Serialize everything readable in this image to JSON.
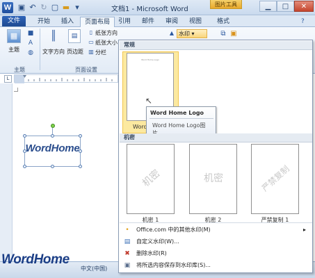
{
  "window": {
    "title": "文档1 - Microsoft Word",
    "context_tab": "图片工具",
    "word_icon": "W",
    "minimize_glyph": "▁",
    "maximize_glyph": "□",
    "close_glyph": "✕"
  },
  "tabs": {
    "file": "文件",
    "items": [
      "开始",
      "插入",
      "页面布局",
      "引用",
      "邮件",
      "审阅",
      "视图",
      "格式"
    ],
    "active": "页面布局"
  },
  "ribbon": {
    "theme_label": "主题",
    "theme_group": "主题",
    "text_direction": "文字方向",
    "margins": "页边距",
    "paper_direction": "纸张方向",
    "paper_size": "纸张大小",
    "columns": "分栏",
    "page_setup_group": "页面设置",
    "watermark": "水印"
  },
  "ruler": {
    "corner": "L"
  },
  "document": {
    "wordart_text": "WordHome"
  },
  "statusbar": {
    "language": "中文(中国)",
    "brand": "WordHome"
  },
  "gallery": {
    "section_general": "常规",
    "section_confidential": "机密",
    "selected_caption_fragment": "Word H",
    "thumb0_title": "Word Home Logo",
    "tooltip": {
      "title": "Word Home Logo",
      "desc_line1": "Word Home Logo图",
      "desc_line2": "片"
    },
    "thumbs": [
      {
        "watermark": "机密",
        "caption": "机密 1"
      },
      {
        "watermark": "机密",
        "caption": "机密 2"
      },
      {
        "watermark": "严禁复制",
        "caption": "严禁复制 1"
      }
    ],
    "menu": [
      {
        "icon": "bullet-icon",
        "glyph": "•",
        "label": "Office.com 中的其他水印(M)",
        "disabled": false,
        "arrow": "▸"
      },
      {
        "icon": "custom-watermark-icon",
        "glyph": "▤",
        "label": "自定义水印(W)...",
        "disabled": false,
        "arrow": ""
      },
      {
        "icon": "delete-watermark-icon",
        "glyph": "✖",
        "label": "删除水印(R)",
        "disabled": false,
        "arrow": ""
      },
      {
        "icon": "save-selection-icon",
        "glyph": "▣",
        "label": "将所选内容保存到水印库(S)...",
        "disabled": false,
        "arrow": ""
      }
    ]
  }
}
